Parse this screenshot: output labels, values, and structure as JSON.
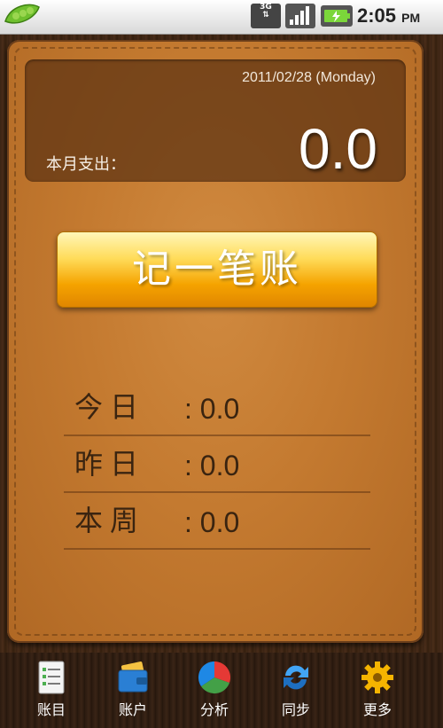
{
  "status_bar": {
    "network": "3G",
    "time": "2:05",
    "ampm": "PM"
  },
  "summary": {
    "date": "2011/02/28  (Monday)",
    "month_label": "本月支出：",
    "month_value": "0.0"
  },
  "record_button": {
    "label": "记一笔账"
  },
  "stats": [
    {
      "label": "今日",
      "value": ": 0.0"
    },
    {
      "label": "昨日",
      "value": ": 0.0"
    },
    {
      "label": "本周",
      "value": ": 0.0"
    }
  ],
  "tabs": [
    {
      "label": "账目",
      "icon": "ledger-icon"
    },
    {
      "label": "账户",
      "icon": "wallet-icon"
    },
    {
      "label": "分析",
      "icon": "pie-chart-icon"
    },
    {
      "label": "同步",
      "icon": "sync-icon"
    },
    {
      "label": "更多",
      "icon": "gear-icon"
    }
  ],
  "colors": {
    "leather": "#c47a30",
    "button_orange": "#f5a300",
    "summary_panel": "#5c3212"
  }
}
